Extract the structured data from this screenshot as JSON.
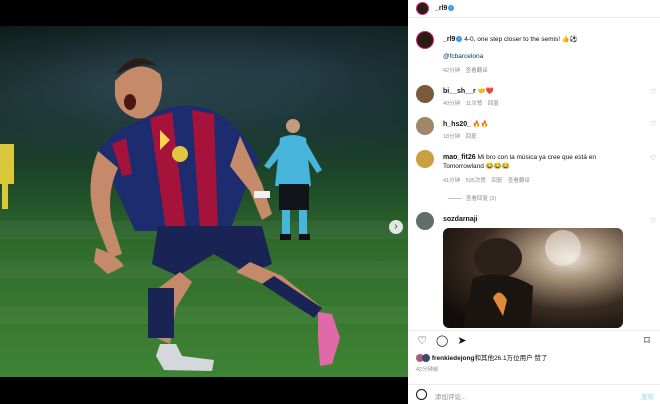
{
  "post": {
    "author": "_rl9",
    "caption_username": "_rl9",
    "caption": "4-0, one step closer to the semis! 👍⚽",
    "mention": "@fcbarcelona",
    "caption_time": "42分钟",
    "translate": "查看翻译"
  },
  "comments": [
    {
      "username": "bi__sh__r",
      "text": "🤝❤️",
      "time": "40分钟",
      "likes": "11次赞",
      "reply": "回复"
    },
    {
      "username": "h_hs20_",
      "text": "🔥🔥",
      "time": "18分钟",
      "reply": "回复"
    },
    {
      "username": "mao_fit26",
      "text": "Mi bro con la música ya cree que está en Tomorrowland 😂😂😂",
      "time": "41分钟",
      "likes": "535次赞",
      "reply": "回复",
      "translate": "查看翻译",
      "view_replies": "查看回复 (2)"
    },
    {
      "username": "sozdarnaji"
    }
  ],
  "likes_line": {
    "user": "frenkiedejong",
    "rest": "和其他26.1万位用户 赞了"
  },
  "post_time": "42分钟前",
  "composer": {
    "placeholder": "添加评论...",
    "post_label": "发布"
  },
  "colors": {
    "link": "#00376b",
    "verified": "#3897f0",
    "muted": "#8e8e8e"
  },
  "icons": [
    "heart-icon",
    "comment-icon",
    "share-icon",
    "bookmark-icon",
    "emoji-icon",
    "chevron-right-icon"
  ]
}
